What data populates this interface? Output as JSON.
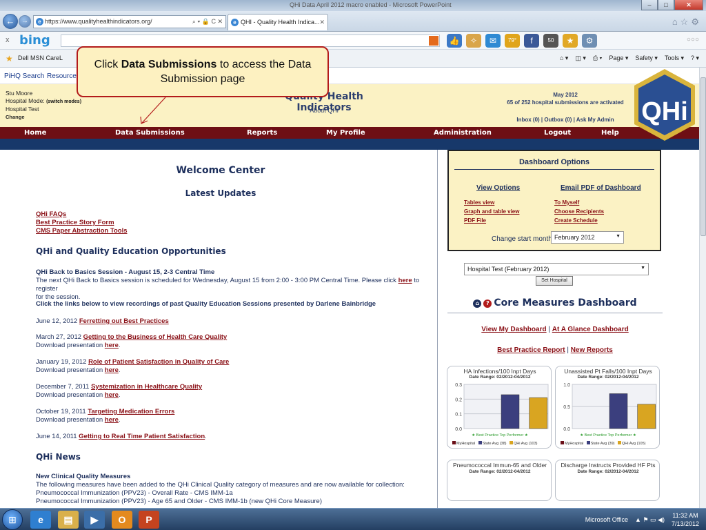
{
  "browser": {
    "window_title": "QHi Data April 2012 macro enabled - Microsoft PowerPoint",
    "address": "https://www.qualityhealthindicators.org/",
    "address_tools": "⌕ ▾ 🔒 C ✕",
    "tab_title": "QHI - Quality Health Indica...",
    "bing": "bing",
    "fav_items": "Dell  MSN   CareL",
    "cmd": [
      "Page ▾",
      "Safety ▾",
      "Tools ▾",
      "? ▾"
    ],
    "toolbar_badges": [
      "79°",
      "50"
    ]
  },
  "links": {
    "pihq": "PiHQ Search",
    "resource": "Resource"
  },
  "header": {
    "user": "Stu Moore",
    "mode_label": "Hospital Mode:",
    "switch": "(switch modes)",
    "hospital": "Hospital Test",
    "change": "Change",
    "title": "Quality Health Indicators",
    "about": "About QHi",
    "month": "May 2012",
    "activated": "65 of 252 hospital submissions are activated",
    "mail": "Inbox (0) | Outbox (0) | Ask My Admin",
    "logo": "QHi"
  },
  "menu": [
    "Home",
    "Data Submissions",
    "Reports",
    "My Profile",
    "Administration",
    "Logout",
    "Help"
  ],
  "left": {
    "welcome": "Welcome Center",
    "latest": "Latest Updates",
    "quick_links": [
      "QHi FAQs",
      "Best Practice Story Form",
      "CMS Paper Abstraction Tools"
    ],
    "edu_heading": "QHi and Quality Education Opportunities",
    "b2b_title": "QHi Back to Basics Session - August 15, 2-3 Central Time",
    "b2b_text1": "The next QHi Back to Basics session is scheduled for Wednesday, August 15 from 2:00 - 3:00 PM Central Time. Please click",
    "b2b_here": "here",
    "b2b_text2": "to register",
    "b2b_text3": "for the session.",
    "recordings": "Click the links below to view recordings of past Quality Education Sessions presented by Darlene Bainbridge",
    "sessions": [
      {
        "date": "June 12, 2012",
        "title": "Ferretting out Best Practices",
        "download": ""
      },
      {
        "date": "March 27, 2012",
        "title": "Getting to the Business of Health Care Quality",
        "download": "Download presentation"
      },
      {
        "date": "January 19, 2012",
        "title": "Role of Patient Satisfaction in Quality of Care",
        "download": "Download presentation"
      },
      {
        "date": "December 7, 2011",
        "title": "Systemization in Healthcare Quality",
        "download": "Download presentation"
      },
      {
        "date": "October 19, 2011",
        "title": "Targeting Medication Errors",
        "download": "Download presentation"
      },
      {
        "date": "June 14, 2011",
        "title": "Getting to Real Time Patient Satisfaction",
        "download": ""
      }
    ],
    "here": "here",
    "news_heading": "QHi News",
    "news_title": "New Clinical Quality Measures",
    "news_text": "The following measures have been added to the QHi Clinical Quality category of measures and are now available for collection:",
    "news_items": [
      "Pneumococcal Immunization (PPV23) - Overall Rate - CMS IMM-1a",
      "Pneumococcal Immunization (PPV23) - Age 65 and Older - CMS IMM-1b (new QHi Core Measure)"
    ]
  },
  "right": {
    "dash_title": "Dashboard Options",
    "view_options": "View Options",
    "email_pdf": "Email PDF of Dashboard",
    "view_links": [
      "Tables view",
      "Graph and table view",
      "PDF File"
    ],
    "email_links": [
      "To Myself",
      "Choose Recipients",
      "Create Schedule"
    ],
    "start_month_label": "Change start month:",
    "start_month": "February 2012",
    "hospital_select": "Hospital Test (February 2012)",
    "set_hospital": "Set Hospital",
    "core_title": "Core Measures Dashboard",
    "view_dash": "View My Dashboard",
    "glance": "At A Glance Dashboard",
    "bp_report": "Best Practice Report",
    "new_reports": "New Reports",
    "card3_title": "Pneumococcal Immun-65 and Older",
    "card4_title": "Discharge Instructs Provided HF Pts",
    "date_range": "Date Range: 02/2012-04/2012"
  },
  "chart_data": [
    {
      "type": "bar",
      "title": "HA Infections/100 Inpt Days",
      "subtitle": "Date Range: 02/2012-04/2012",
      "categories": [
        "MyHospital",
        "State Avg (38)",
        "QHi Avg (103)"
      ],
      "values": [
        0,
        0.23,
        0.21
      ],
      "ylim": [
        0,
        0.3
      ],
      "yticks": [
        "0.3",
        "0.2",
        "0.1",
        "0.0"
      ],
      "note": "★ Best Practice Top Performer ★",
      "colors": [
        "#6b0f18",
        "#3b3f7e",
        "#d9a521"
      ]
    },
    {
      "type": "bar",
      "title": "Unassisted Pt Falls/100 Inpt Days",
      "subtitle": "Date Range: 02/2012-04/2012",
      "categories": [
        "MyHospital",
        "State Avg (39)",
        "QHi Avg (105)"
      ],
      "values": [
        0,
        0.79,
        0.55
      ],
      "ylim": [
        0,
        1.0
      ],
      "yticks": [
        "1.0",
        "0.5",
        "0.0"
      ],
      "note": "★ Best Practice Top Performer ★",
      "colors": [
        "#6b0f18",
        "#3b3f7e",
        "#d9a521"
      ]
    }
  ],
  "callout": {
    "pre": "Click ",
    "bold": "Data Submissions",
    "post": " to access the Data Submission page"
  },
  "taskbar": {
    "tray_label": "Microsoft Office",
    "time": "11:32 AM",
    "date": "7/13/2012"
  }
}
